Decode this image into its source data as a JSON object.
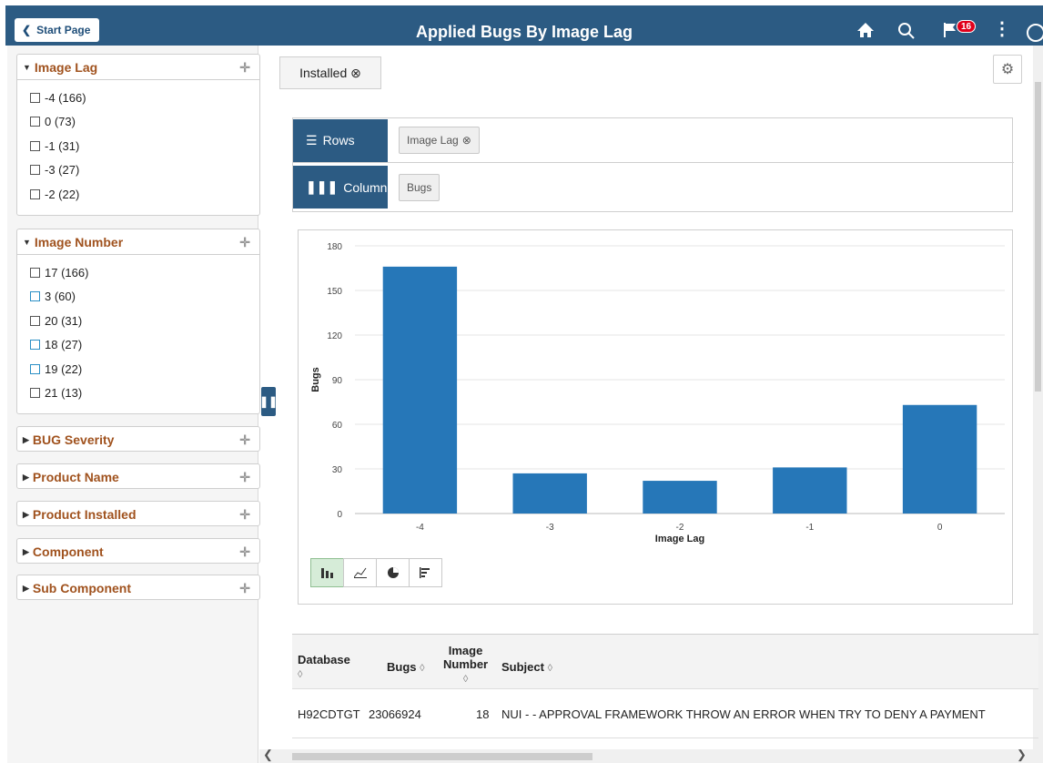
{
  "header": {
    "start_label": "Start Page",
    "title": "Applied Bugs By Image Lag",
    "notification_count": "16",
    "icons": [
      "home-icon",
      "search-icon",
      "flag-icon",
      "kebab-icon",
      "navbar-icon"
    ],
    "bar_color": "#2c5b83"
  },
  "sidebar": {
    "facets": [
      {
        "title": "Image Lag",
        "expanded": true,
        "items": [
          {
            "label": "-4 (166)",
            "checked": false
          },
          {
            "label": "0 (73)",
            "checked": false
          },
          {
            "label": "-1 (31)",
            "checked": false
          },
          {
            "label": "-3 (27)",
            "checked": false
          },
          {
            "label": "-2 (22)",
            "checked": false
          }
        ]
      },
      {
        "title": "Image Number",
        "expanded": true,
        "items": [
          {
            "label": "17 (166)",
            "checked": false
          },
          {
            "label": "3 (60)",
            "checked": false
          },
          {
            "label": "20 (31)",
            "checked": false
          },
          {
            "label": "18 (27)",
            "checked": false
          },
          {
            "label": "19 (22)",
            "checked": false
          },
          {
            "label": "21 (13)",
            "checked": false
          }
        ]
      },
      {
        "title": "BUG Severity",
        "expanded": false
      },
      {
        "title": "Product Name",
        "expanded": false
      },
      {
        "title": "Product Installed",
        "expanded": false
      },
      {
        "title": "Component",
        "expanded": false
      },
      {
        "title": "Sub Component",
        "expanded": false
      }
    ],
    "facet_title_color": "#a0521e"
  },
  "main": {
    "filter_chip": "Installed",
    "pivot": {
      "rows_label": "Rows",
      "rows_field": "Image Lag",
      "columns_label": "Columns",
      "columns_field": "Bugs"
    },
    "chart_types": [
      "bar-chart-icon",
      "line-chart-icon",
      "pie-chart-icon",
      "horizontal-bar-chart-icon"
    ],
    "chart_data": {
      "type": "bar",
      "categories": [
        "-4",
        "-3",
        "-2",
        "-1",
        "0"
      ],
      "values": [
        166,
        27,
        22,
        31,
        73
      ],
      "xlabel": "Image Lag",
      "ylabel": "Bugs",
      "ylim": [
        0,
        180
      ],
      "yticks": [
        0,
        30,
        60,
        90,
        120,
        150,
        180
      ],
      "grid": true,
      "legend": "none",
      "bar_color": "#2677b8"
    },
    "table": {
      "headers": {
        "database": "Database",
        "bugs": "Bugs",
        "image_number_1": "Image",
        "image_number_2": "Number",
        "subject": "Subject"
      },
      "rows": [
        {
          "database": "H92CDTGT",
          "bugs": "23066924",
          "image_number": "18",
          "subject": "NUI - - APPROVAL FRAMEWORK THROW AN ERROR WHEN TRY TO DENY A PAYMENT"
        }
      ]
    }
  }
}
